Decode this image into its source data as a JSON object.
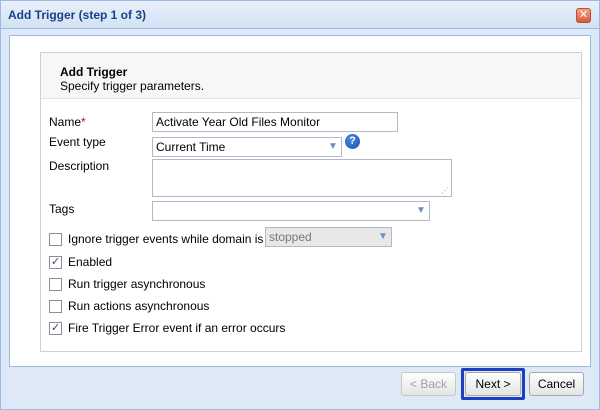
{
  "window": {
    "title": "Add Trigger (step 1 of 3)",
    "close_glyph": "✕"
  },
  "header": {
    "title": "Add Trigger",
    "subtitle": "Specify trigger parameters."
  },
  "form": {
    "name_label": "Name",
    "required_mark": "*",
    "name_value": "Activate Year Old Files Monitor",
    "event_type_label": "Event type",
    "event_type_value": "Current Time",
    "help_glyph": "?",
    "description_label": "Description",
    "description_value": "",
    "tags_label": "Tags",
    "tags_value": ""
  },
  "options": {
    "ignore_label": "Ignore trigger events while domain is",
    "ignore_checked": false,
    "ignore_state_value": "stopped",
    "enabled_label": "Enabled",
    "enabled_checked": true,
    "run_trigger_async_label": "Run trigger asynchronous",
    "run_trigger_async_checked": false,
    "run_actions_async_label": "Run actions asynchronous",
    "run_actions_async_checked": false,
    "fire_error_label": "Fire Trigger Error event if an error occurs",
    "fire_error_checked": true
  },
  "buttons": {
    "back_label": "< Back",
    "next_label": "Next >",
    "cancel_label": "Cancel"
  },
  "icons": {
    "check_glyph": "✓",
    "dropdown_glyph": "▼",
    "resize_glyph": "⋰"
  }
}
